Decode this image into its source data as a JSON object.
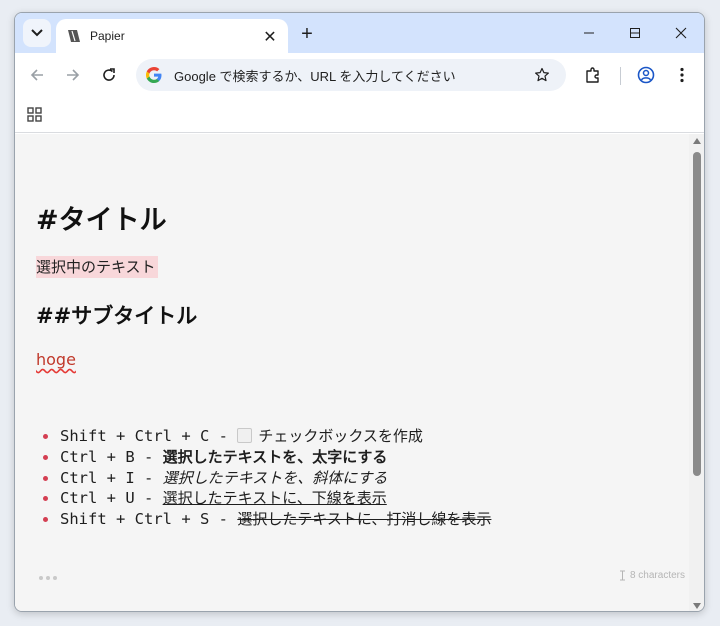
{
  "browser": {
    "tab_title": "Papier",
    "tab_close": "✕",
    "new_tab": "+",
    "omnibox_placeholder": "Google で検索するか、URL を入力してください"
  },
  "editor": {
    "heading1": "#タイトル",
    "selected_text": "選択中のテキスト",
    "heading2": "##サブタイトル",
    "misspelled": "hoge",
    "shortcuts": [
      {
        "keys": "Shift + Ctrl + C  - ",
        "demo": "チェックボックスを作成",
        "style": "checkbox"
      },
      {
        "keys": "Ctrl + B  - ",
        "demo": "選択したテキストを、太字にする",
        "style": "bold"
      },
      {
        "keys": "Ctrl + I  - ",
        "demo": "選択したテキストを、斜体にする",
        "style": "italic"
      },
      {
        "keys": "Ctrl + U  - ",
        "demo": "選択したテキストに、下線を表示",
        "style": "underline"
      },
      {
        "keys": "Shift + Ctrl + S  - ",
        "demo": "選択したテキストに、打消し線を表示",
        "style": "strikethrough"
      }
    ],
    "char_count": "8 characters"
  },
  "colors": {
    "tabstrip_bg": "#d3e3fd",
    "selection_highlight": "#f8d7da",
    "bullet": "#d43f52",
    "misspelled_text": "#c0392b"
  },
  "icons": [
    "tab-search-icon",
    "papier-favicon",
    "close-icon",
    "plus-icon",
    "minimize-icon",
    "maximize-icon",
    "window-close-icon",
    "back-icon",
    "forward-icon",
    "reload-icon",
    "google-logo-icon",
    "star-icon",
    "extensions-icon",
    "profile-icon",
    "menu-icon",
    "apps-icon",
    "more-icon",
    "cursor-icon"
  ]
}
